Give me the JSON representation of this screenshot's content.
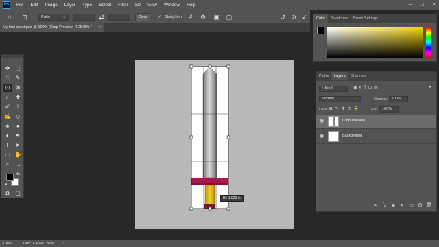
{
  "menubar": {
    "logo": "Ps",
    "items": [
      "File",
      "Edit",
      "Image",
      "Layer",
      "Type",
      "Select",
      "Filter",
      "3D",
      "View",
      "Window",
      "Help"
    ],
    "window_controls": [
      "–",
      "□",
      "✕"
    ]
  },
  "options_bar": {
    "ratio_label": "Ratio",
    "clear_label": "Clear",
    "straighten_label": "Straighten"
  },
  "document": {
    "tab_title": "My first asset.psd @ 100% (Crop Preview, RGB/8#) *",
    "tab_close": "×",
    "measure_tooltip": "H : 1.920 in"
  },
  "status_bar": {
    "zoom": "100%",
    "doc_info": "Doc: 1.40M/1.87M",
    "arrow": "›"
  },
  "color_panel": {
    "tabs": [
      "Color",
      "Swatches",
      "Brush Settings"
    ],
    "active_tab": "Color"
  },
  "layers_panel": {
    "tabs": [
      "Paths",
      "Layers",
      "Channels"
    ],
    "active_tab": "Layers",
    "search_kind": "Kind",
    "blend_mode": "Normal",
    "opacity_label": "Opacity:",
    "opacity_value": "100%",
    "lock_label": "Lock:",
    "fill_label": "Fill:",
    "fill_value": "100%",
    "layers": [
      {
        "name": "Crop Preview",
        "selected": true
      },
      {
        "name": "Background",
        "selected": false
      }
    ]
  },
  "colors": {
    "chrome": "#535353",
    "workspace": "#282828",
    "artboard": "#b8b8b8",
    "blade_dark": "#6f6f6f",
    "blade_light": "#d8d8d8",
    "guard": "#b0144f",
    "grip": "#e8c21a",
    "pommel": "#7a1a3a",
    "ps_blue": "#31a8ff",
    "picker_hue": "#f2d400"
  }
}
